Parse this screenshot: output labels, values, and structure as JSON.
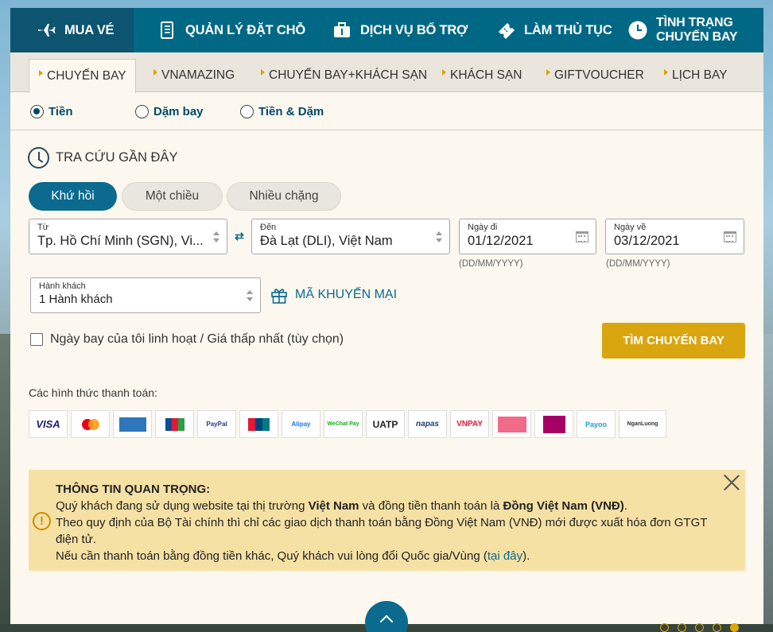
{
  "nav": {
    "items": [
      {
        "label": "MUA VÉ",
        "icon": "plane-icon",
        "active": true
      },
      {
        "label": "QUẢN LÝ ĐẶT CHỖ",
        "icon": "booklet-icon"
      },
      {
        "label": "DỊCH VỤ BỔ TRỢ",
        "icon": "luggage-icon"
      },
      {
        "label": "LÀM THỦ TỤC",
        "icon": "ticket-icon"
      },
      {
        "label_line1": "TÌNH TRẠNG",
        "label_line2": "CHUYẾN BAY",
        "icon": "clock-icon"
      }
    ]
  },
  "tabs": [
    "CHUYẾN BAY",
    "VNAMAZING",
    "CHUYẾN BAY+KHÁCH SẠN",
    "KHÁCH SẠN",
    "GIFTVOUCHER",
    "LỊCH BAY"
  ],
  "pay_mode": {
    "options": [
      "Tiền",
      "Dặm bay",
      "Tiền & Dặm"
    ],
    "selected": "Tiền"
  },
  "recent_search_label": "TRA CỨU GẦN ĐÂY",
  "trip_type": {
    "options": [
      "Khứ hồi",
      "Một chiều",
      "Nhiều chặng"
    ],
    "selected": "Khứ hồi"
  },
  "from": {
    "label": "Từ",
    "value": "Tp. Hồ Chí Minh (SGN), Vi..."
  },
  "to": {
    "label": "Đến",
    "value": "Đà Lạt (DLI), Việt Nam"
  },
  "depart": {
    "label": "Ngày đi",
    "value": "01/12/2021",
    "hint": "(DD/MM/YYYY)"
  },
  "return": {
    "label": "Ngày về",
    "value": "03/12/2021",
    "hint": "(DD/MM/YYYY)"
  },
  "passengers": {
    "label": "Hành khách",
    "value": "1 Hành khách"
  },
  "promo_label": "MÃ KHUYẾN MẠI",
  "flexible_label": "Ngày bay của tôi linh hoạt / Giá thấp nhất (tùy chọn)",
  "search_button": "TÌM CHUYẾN BAY",
  "payment_methods_label": "Các hình thức thanh toán:",
  "payment_methods": [
    "VISA",
    "Mastercard",
    "AMEX",
    "JCB",
    "PayPal",
    "UnionPay",
    "Alipay",
    "WeChat Pay",
    "UATP",
    "napas",
    "VNPAY",
    "Vietcombank",
    "MoMo",
    "Payoo",
    "NganLuong"
  ],
  "notice": {
    "title": "THÔNG TIN QUAN TRỌNG:",
    "line1_a": "Quý khách đang sử dụng website tại thị trường ",
    "line1_b": "Việt Nam",
    "line1_c": " và đồng tiền thanh toán là ",
    "line1_d": "Đồng Việt Nam (VNĐ)",
    "line1_e": ".",
    "line2": "Theo quy định của Bộ Tài chính thì chỉ các giao dịch thanh toán bằng Đồng Việt Nam (VNĐ) mới được xuất hóa đơn GTGT điện tử.",
    "line3_a": "Nếu cần thanh toán bằng đồng tiền khác, Quý khách vui lòng đổi Quốc gia/Vùng (",
    "line3_link": "tại đây",
    "line3_b": ")."
  },
  "carousel": {
    "count": 5,
    "active_index": 4
  },
  "colors": {
    "nav": "#006885",
    "accent": "#0b6a8e",
    "button": "#d9a60f",
    "notice_bg": "#f6e1a5"
  }
}
